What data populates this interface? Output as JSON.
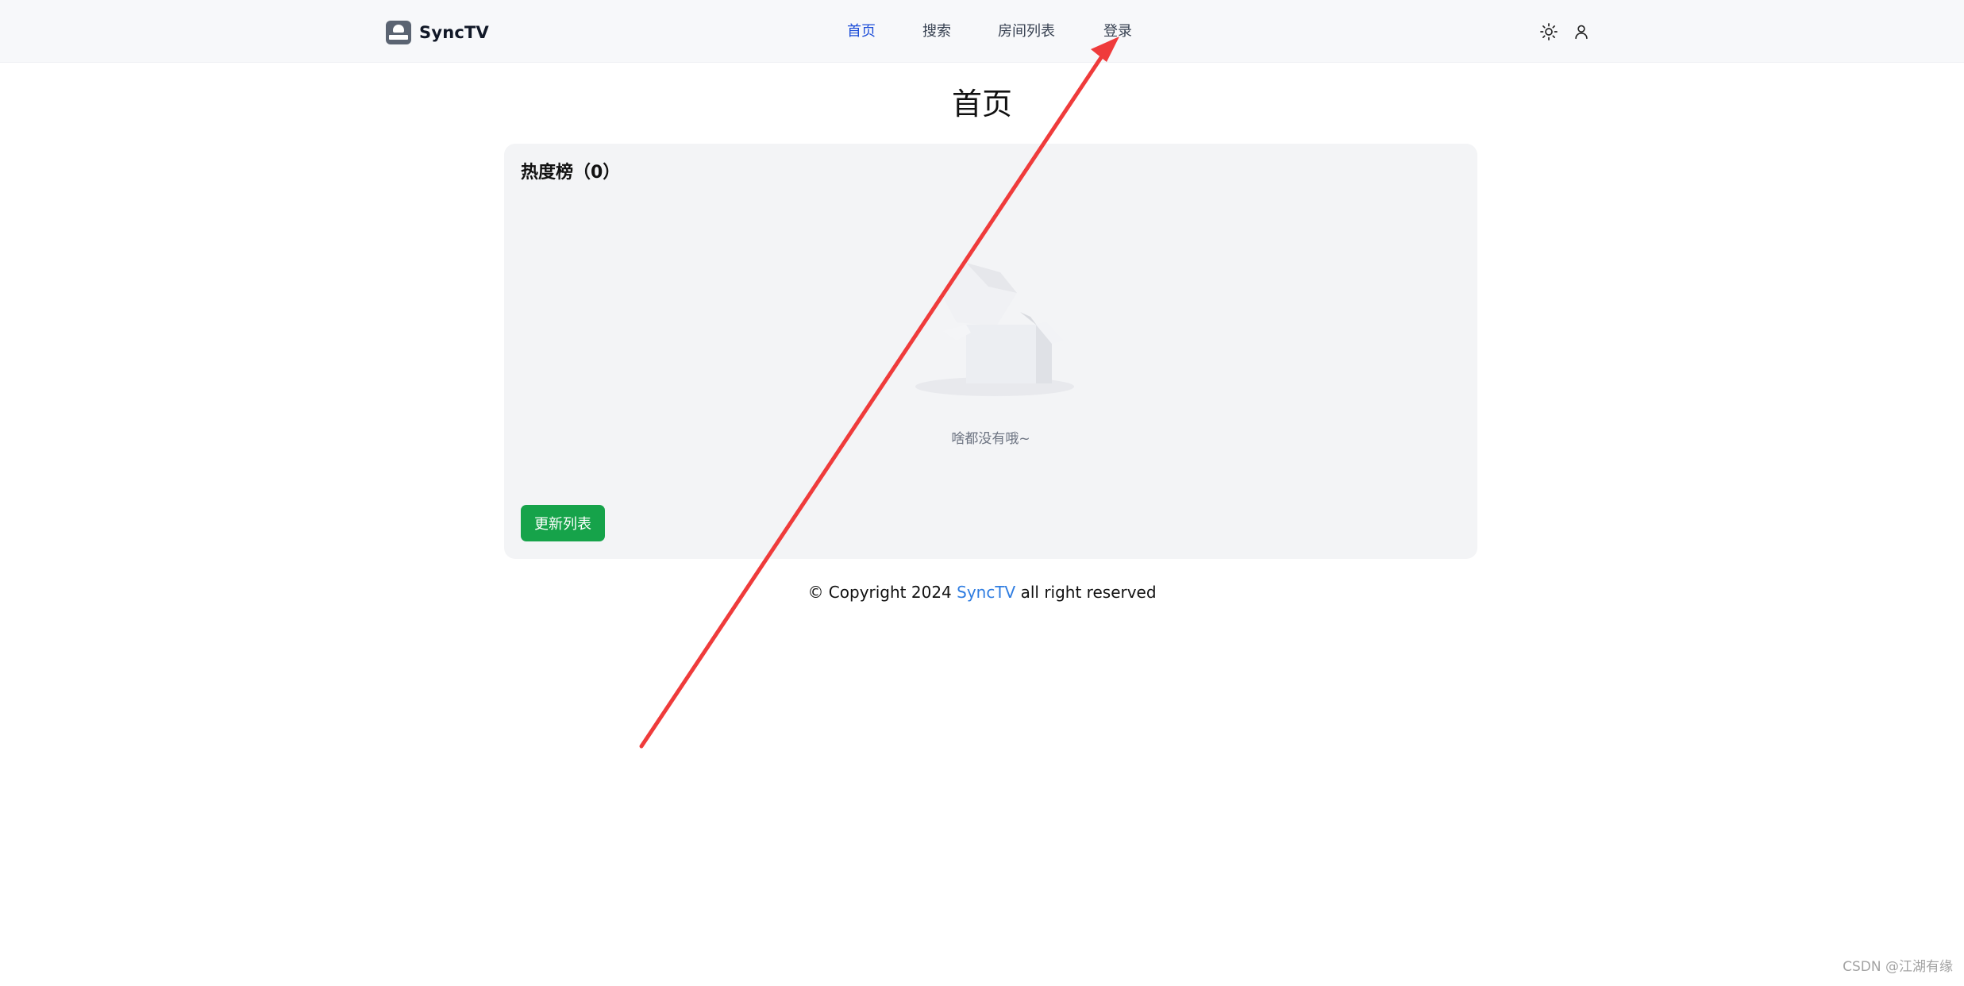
{
  "header": {
    "brand": "SyncTV",
    "nav": [
      {
        "label": "首页",
        "active": true
      },
      {
        "label": "搜索",
        "active": false
      },
      {
        "label": "房间列表",
        "active": false
      },
      {
        "label": "登录",
        "active": false
      }
    ],
    "icons": [
      "sun-icon",
      "user-icon"
    ]
  },
  "main": {
    "title": "首页",
    "hot": {
      "title": "热度榜（0）",
      "empty_text": "啥都没有哦~",
      "refresh_label": "更新列表"
    }
  },
  "footer": {
    "prefix": "© Copyright 2024 ",
    "link": "SyncTV",
    "suffix": " all right reserved"
  },
  "watermark": "CSDN @江湖有缘",
  "colors": {
    "header_bg": "#f7f8fa",
    "nav_active": "#1d4ed8",
    "card_bg": "#f3f4f6",
    "button_green": "#16a34a",
    "link_blue": "#2f7de1",
    "annotation_red": "#ef3b3b"
  }
}
